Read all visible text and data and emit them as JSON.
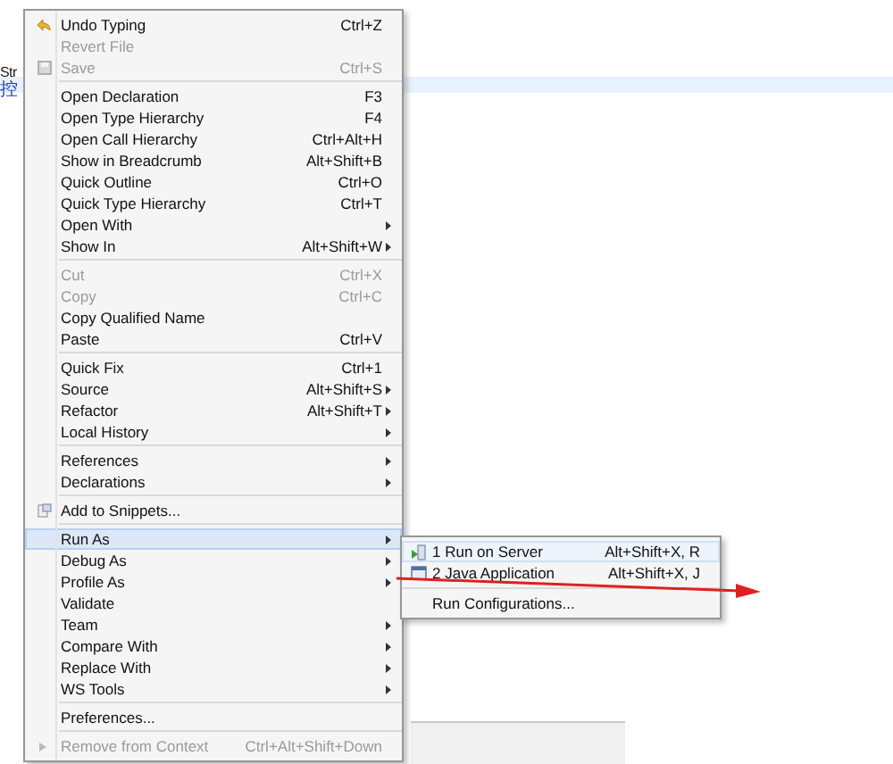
{
  "editor": {
    "lines": [
      {
        "text": "Str",
        "kind": "code"
      },
      {
        "text": "控",
        "kind": "link"
      }
    ]
  },
  "context_menu": {
    "groups": [
      [
        {
          "label": "Undo Typing",
          "shortcut": "Ctrl+Z",
          "disabled": false,
          "submenu": false,
          "selected": false
        },
        {
          "label": "Revert File",
          "disabled": true,
          "submenu": false,
          "selected": false
        },
        {
          "label": "Save",
          "shortcut": "Ctrl+S",
          "disabled": true,
          "submenu": false,
          "selected": false
        }
      ],
      [
        {
          "label": "Open Declaration",
          "shortcut": "F3",
          "disabled": false,
          "submenu": false,
          "selected": false
        },
        {
          "label": "Open Type Hierarchy",
          "shortcut": "F4",
          "disabled": false,
          "submenu": false,
          "selected": false
        },
        {
          "label": "Open Call Hierarchy",
          "shortcut": "Ctrl+Alt+H",
          "disabled": false,
          "submenu": false,
          "selected": false
        },
        {
          "label": "Show in Breadcrumb",
          "shortcut": "Alt+Shift+B",
          "disabled": false,
          "submenu": false,
          "selected": false
        },
        {
          "label": "Quick Outline",
          "shortcut": "Ctrl+O",
          "disabled": false,
          "submenu": false,
          "selected": false
        },
        {
          "label": "Quick Type Hierarchy",
          "shortcut": "Ctrl+T",
          "disabled": false,
          "submenu": false,
          "selected": false
        },
        {
          "label": "Open With",
          "disabled": false,
          "submenu": true,
          "selected": false
        },
        {
          "label": "Show In",
          "shortcut": "Alt+Shift+W",
          "disabled": false,
          "submenu": true,
          "selected": false
        }
      ],
      [
        {
          "label": "Cut",
          "shortcut": "Ctrl+X",
          "disabled": true,
          "submenu": false,
          "selected": false
        },
        {
          "label": "Copy",
          "shortcut": "Ctrl+C",
          "disabled": true,
          "submenu": false,
          "selected": false
        },
        {
          "label": "Copy Qualified Name",
          "disabled": false,
          "submenu": false,
          "selected": false
        },
        {
          "label": "Paste",
          "shortcut": "Ctrl+V",
          "disabled": false,
          "submenu": false,
          "selected": false
        }
      ],
      [
        {
          "label": "Quick Fix",
          "shortcut": "Ctrl+1",
          "disabled": false,
          "submenu": false,
          "selected": false
        },
        {
          "label": "Source",
          "shortcut": "Alt+Shift+S",
          "disabled": false,
          "submenu": true,
          "selected": false
        },
        {
          "label": "Refactor",
          "shortcut": "Alt+Shift+T",
          "disabled": false,
          "submenu": true,
          "selected": false
        },
        {
          "label": "Local History",
          "disabled": false,
          "submenu": true,
          "selected": false
        }
      ],
      [
        {
          "label": "References",
          "disabled": false,
          "submenu": true,
          "selected": false
        },
        {
          "label": "Declarations",
          "disabled": false,
          "submenu": true,
          "selected": false
        }
      ],
      [
        {
          "label": "Add to Snippets...",
          "disabled": false,
          "submenu": false,
          "selected": false
        }
      ],
      [
        {
          "label": "Run As",
          "disabled": false,
          "submenu": true,
          "selected": true
        },
        {
          "label": "Debug As",
          "disabled": false,
          "submenu": true,
          "selected": false
        },
        {
          "label": "Profile As",
          "disabled": false,
          "submenu": true,
          "selected": false
        },
        {
          "label": "Validate",
          "disabled": false,
          "submenu": false,
          "selected": false
        },
        {
          "label": "Team",
          "disabled": false,
          "submenu": true,
          "selected": false
        },
        {
          "label": "Compare With",
          "disabled": false,
          "submenu": true,
          "selected": false
        },
        {
          "label": "Replace With",
          "disabled": false,
          "submenu": true,
          "selected": false
        },
        {
          "label": "WS Tools",
          "disabled": false,
          "submenu": true,
          "selected": false
        }
      ],
      [
        {
          "label": "Preferences...",
          "disabled": false,
          "submenu": false,
          "selected": false
        }
      ],
      [
        {
          "label": "Remove from Context",
          "shortcut": "Ctrl+Alt+Shift+Down",
          "disabled": true,
          "submenu": false,
          "selected": false
        }
      ]
    ]
  },
  "submenu": {
    "groups": [
      [
        {
          "label": "1 Run on Server",
          "shortcut": "Alt+Shift+X, R",
          "selected": true
        },
        {
          "label": "2 Java Application",
          "shortcut": "Alt+Shift+X, J",
          "selected": false
        }
      ],
      [
        {
          "label": "Run Configurations...",
          "selected": false
        }
      ]
    ]
  }
}
